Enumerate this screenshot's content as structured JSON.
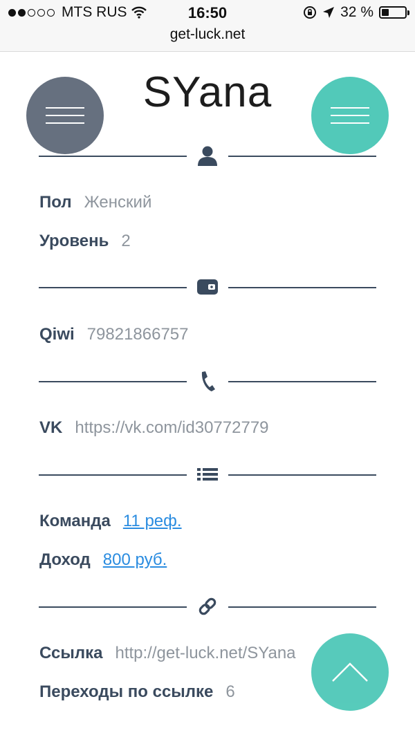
{
  "status_bar": {
    "carrier": "MTS RUS",
    "time": "16:50",
    "battery_percent": "32 %",
    "battery_level": 0.32,
    "signal_bars_filled": 2,
    "url": "get-luck.net"
  },
  "profile": {
    "username": "SYana"
  },
  "fields": {
    "gender_label": "Пол",
    "gender_value": "Женский",
    "level_label": "Уровень",
    "level_value": "2",
    "qiwi_label": "Qiwi",
    "qiwi_value": "79821866757",
    "vk_label": "VK",
    "vk_value": "https://vk.com/id30772779",
    "team_label": "Команда",
    "team_value": "11 реф.",
    "income_label": "Доход",
    "income_value": "800 руб.",
    "link_label": "Ссылка",
    "link_value": "http://get-luck.net/SYana",
    "clicks_label": "Переходы по ссылке",
    "clicks_value": "6"
  },
  "icons": {
    "user": "user-icon",
    "wallet": "wallet-icon",
    "phone": "phone-icon",
    "list": "list-icon",
    "link": "link-icon",
    "menu": "menu-icon",
    "scroll_top": "chevron-up-icon"
  },
  "colors": {
    "menu_left": "#66707f",
    "accent": "#52c9b9",
    "label": "#3a4a5e",
    "value": "#8e959d",
    "link": "#2a8ce0"
  }
}
